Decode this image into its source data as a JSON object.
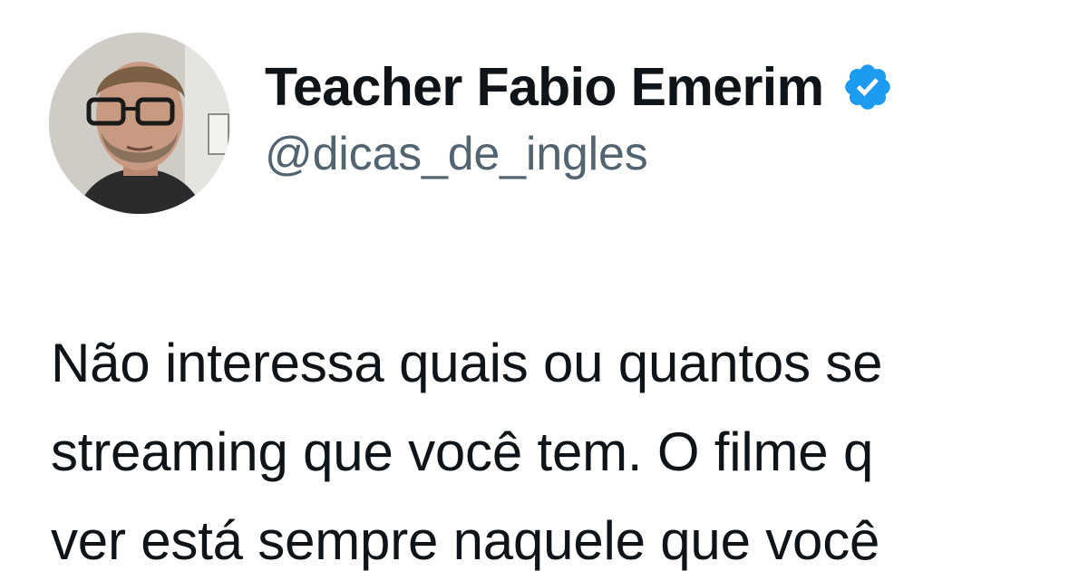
{
  "author": {
    "display_name": "Teacher Fabio Emerim",
    "handle": "@dicas_de_ingles",
    "verified": true,
    "verified_color": "#1d9bf0",
    "avatar_icon": "profile-photo"
  },
  "tweet": {
    "lines": [
      "Não interessa quais ou quantos se",
      "streaming que você tem. O filme q",
      "ver está sempre naquele que você"
    ]
  },
  "colors": {
    "text_primary": "#0f1419",
    "text_secondary": "#536471",
    "background": "#ffffff"
  }
}
